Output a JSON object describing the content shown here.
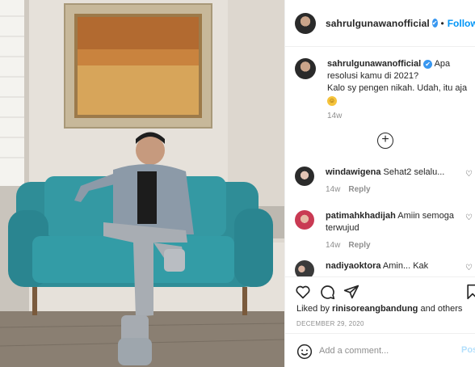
{
  "post": {
    "username": "sahrulgunawanofficial",
    "verified_mark": "✔",
    "follow_label": "Follow",
    "separator": "•",
    "caption_line1": "Apa resolusi kamu di 2021?",
    "caption_line2": "Kalo sy pengen nikah. Udah, itu aja",
    "caption_emoji": "☺",
    "caption_time": "14w",
    "load_more_label": "+"
  },
  "comments": [
    {
      "user": "windawigena",
      "text": "Sehat2 selalu...",
      "time": "14w",
      "reply": "Reply",
      "heart": "♡"
    },
    {
      "user": "patimahkhadijah",
      "text": "Amiin semoga terwujud",
      "time": "14w",
      "reply": "Reply",
      "heart": "♡"
    },
    {
      "user": "nadiyaoktora",
      "text": "Amin... Kak",
      "heart": "♡"
    }
  ],
  "footer": {
    "liked_prefix": "Liked by",
    "liked_user": "rinisoreangbandung",
    "liked_suffix": "and others",
    "date": "DECEMBER 29, 2020",
    "comment_placeholder": "Add a comment...",
    "post_label": "Post"
  },
  "colors": {
    "accent": "#0095f6",
    "sofa": "#2f8d97",
    "wall": "#e8e3dc"
  },
  "icons": [
    "heart-icon",
    "comment-icon",
    "share-icon",
    "bookmark-icon",
    "smile-icon",
    "plus-circle-icon",
    "verified-icon"
  ]
}
